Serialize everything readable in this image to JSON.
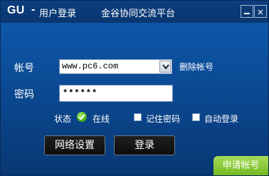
{
  "window": {
    "brand": "GU",
    "brand_sep": "-",
    "title": "用户登录",
    "subtitle": "金谷协同交流平台",
    "minimize_symbol": "",
    "close_symbol": "×"
  },
  "form": {
    "account_label": "帐号",
    "account_value": "www.pc6.com",
    "delete_account_link": "删除帐号",
    "password_label": "密码",
    "password_value": "******",
    "status_label": "状态",
    "status_value": "在线",
    "remember_password_label": "记住密码",
    "auto_login_label": "自动登录"
  },
  "buttons": {
    "network_settings": "网络设置",
    "login": "登录",
    "apply_account": "申请帐号"
  },
  "colors": {
    "accent_blue": "#0c4f9c",
    "title_blue": "#0a3670",
    "status_green": "#49b51e",
    "apply_green": "#8acb3c"
  }
}
